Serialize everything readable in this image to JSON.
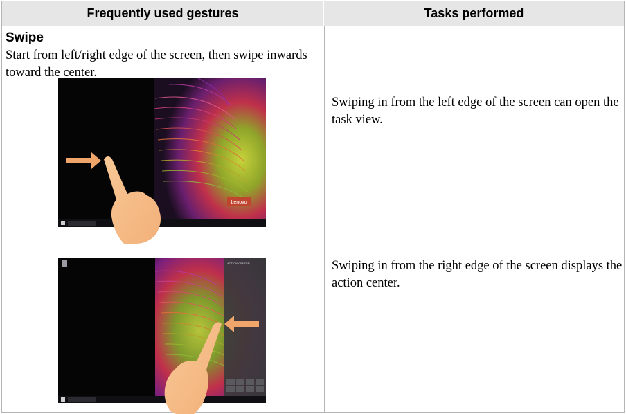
{
  "table": {
    "col_left_header": "Frequently used gestures",
    "col_right_header": "Tasks performed"
  },
  "gesture": {
    "title": "Swipe",
    "description": "Start from left/right edge of the screen, then swipe inwards toward the center."
  },
  "tasks": [
    "Swiping in from the left edge of the screen can open the task view.",
    "Swiping in from the right edge of the screen displays the action center."
  ],
  "screenshots": {
    "left_swipe": {
      "watermark": "Lenovo",
      "arrow_color": "#f0a56a",
      "hand_color": "#f7c08e"
    },
    "right_swipe": {
      "panel_title": "ACTION CENTER",
      "arrow_color": "#f0a56a",
      "hand_color": "#f7c08e"
    }
  }
}
